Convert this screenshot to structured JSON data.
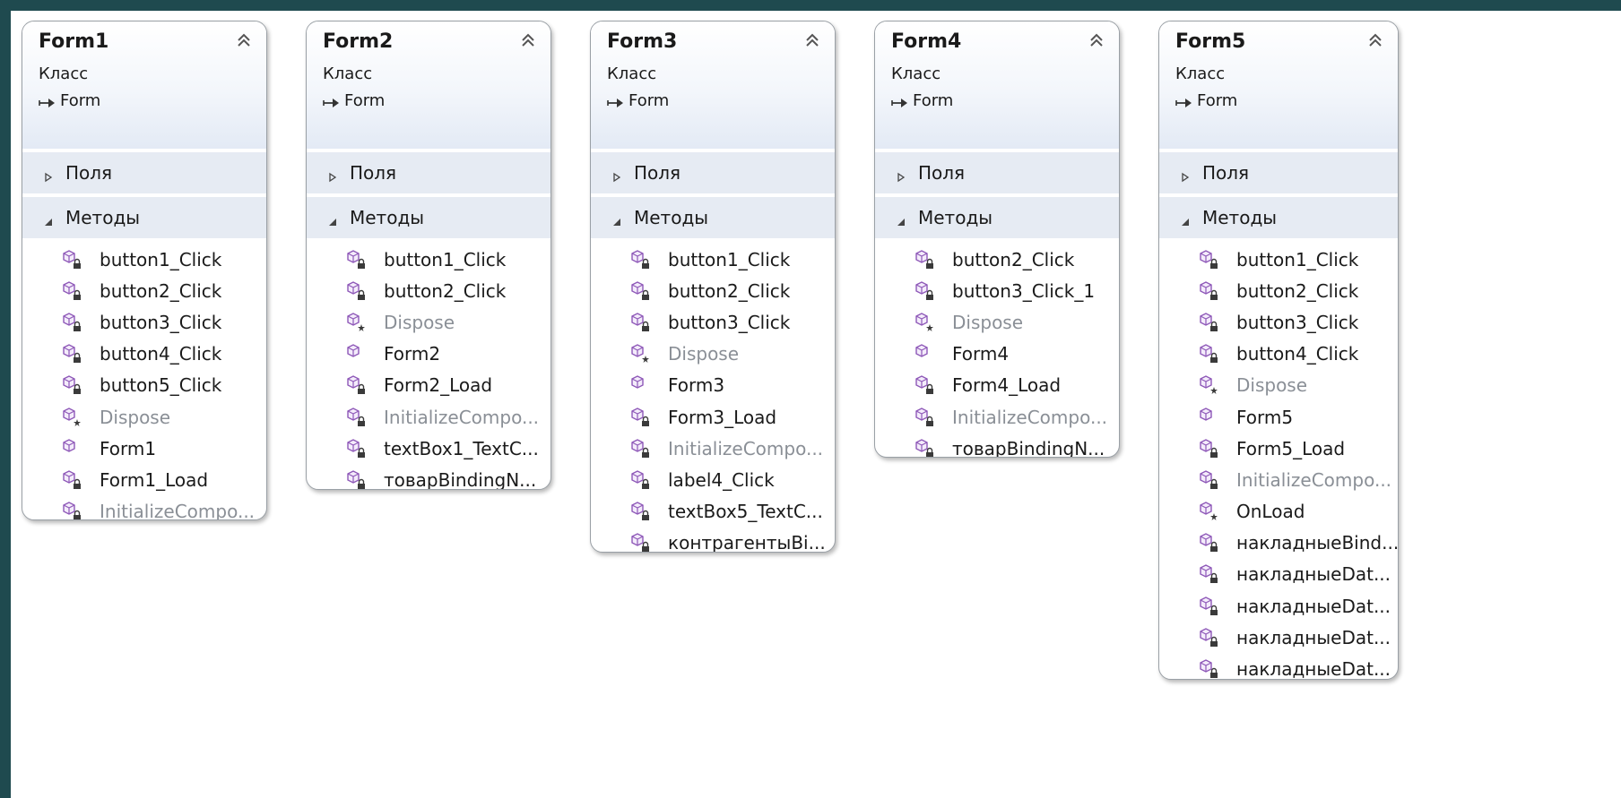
{
  "classes": [
    {
      "name": "Form1",
      "kind": "Класс",
      "base": "Form",
      "fields_label": "Поля",
      "methods_label": "Методы",
      "methods": [
        {
          "name": "button1_Click",
          "access": "private",
          "dim": false
        },
        {
          "name": "button2_Click",
          "access": "private",
          "dim": false
        },
        {
          "name": "button3_Click",
          "access": "private",
          "dim": false
        },
        {
          "name": "button4_Click",
          "access": "private",
          "dim": false
        },
        {
          "name": "button5_Click",
          "access": "private",
          "dim": false
        },
        {
          "name": "Dispose",
          "access": "protected",
          "dim": true
        },
        {
          "name": "Form1",
          "access": "public",
          "dim": false
        },
        {
          "name": "Form1_Load",
          "access": "private",
          "dim": false
        },
        {
          "name": "InitializeCompo...",
          "access": "private",
          "dim": true
        }
      ]
    },
    {
      "name": "Form2",
      "kind": "Класс",
      "base": "Form",
      "fields_label": "Поля",
      "methods_label": "Методы",
      "methods": [
        {
          "name": "button1_Click",
          "access": "private",
          "dim": false
        },
        {
          "name": "button2_Click",
          "access": "private",
          "dim": false
        },
        {
          "name": "Dispose",
          "access": "protected",
          "dim": true
        },
        {
          "name": "Form2",
          "access": "public",
          "dim": false
        },
        {
          "name": "Form2_Load",
          "access": "private",
          "dim": false
        },
        {
          "name": "InitializeCompo...",
          "access": "private",
          "dim": true
        },
        {
          "name": "textBox1_TextC...",
          "access": "private",
          "dim": false
        },
        {
          "name": "товарBindingN...",
          "access": "private",
          "dim": false
        }
      ]
    },
    {
      "name": "Form3",
      "kind": "Класс",
      "base": "Form",
      "fields_label": "Поля",
      "methods_label": "Методы",
      "methods": [
        {
          "name": "button1_Click",
          "access": "private",
          "dim": false
        },
        {
          "name": "button2_Click",
          "access": "private",
          "dim": false
        },
        {
          "name": "button3_Click",
          "access": "private",
          "dim": false
        },
        {
          "name": "Dispose",
          "access": "protected",
          "dim": true
        },
        {
          "name": "Form3",
          "access": "public",
          "dim": false
        },
        {
          "name": "Form3_Load",
          "access": "private",
          "dim": false
        },
        {
          "name": "InitializeCompo...",
          "access": "private",
          "dim": true
        },
        {
          "name": "label4_Click",
          "access": "private",
          "dim": false
        },
        {
          "name": "textBox5_TextC...",
          "access": "private",
          "dim": false
        },
        {
          "name": "контрагентыBi...",
          "access": "private",
          "dim": false
        }
      ]
    },
    {
      "name": "Form4",
      "kind": "Класс",
      "base": "Form",
      "fields_label": "Поля",
      "methods_label": "Методы",
      "methods": [
        {
          "name": "button2_Click",
          "access": "private",
          "dim": false
        },
        {
          "name": "button3_Click_1",
          "access": "private",
          "dim": false
        },
        {
          "name": "Dispose",
          "access": "protected",
          "dim": true
        },
        {
          "name": "Form4",
          "access": "public",
          "dim": false
        },
        {
          "name": "Form4_Load",
          "access": "private",
          "dim": false
        },
        {
          "name": "InitializeCompo...",
          "access": "private",
          "dim": true
        },
        {
          "name": "товарBindingN...",
          "access": "private",
          "dim": false
        }
      ]
    },
    {
      "name": "Form5",
      "kind": "Класс",
      "base": "Form",
      "fields_label": "Поля",
      "methods_label": "Методы",
      "methods": [
        {
          "name": "button1_Click",
          "access": "private",
          "dim": false
        },
        {
          "name": "button2_Click",
          "access": "private",
          "dim": false
        },
        {
          "name": "button3_Click",
          "access": "private",
          "dim": false
        },
        {
          "name": "button4_Click",
          "access": "private",
          "dim": false
        },
        {
          "name": "Dispose",
          "access": "protected",
          "dim": true
        },
        {
          "name": "Form5",
          "access": "public",
          "dim": false
        },
        {
          "name": "Form5_Load",
          "access": "private",
          "dim": false
        },
        {
          "name": "InitializeCompo...",
          "access": "private",
          "dim": true
        },
        {
          "name": "OnLoad",
          "access": "protected",
          "dim": false
        },
        {
          "name": "накладныеBind...",
          "access": "private",
          "dim": false
        },
        {
          "name": "накладныеDat...",
          "access": "private",
          "dim": false
        },
        {
          "name": "накладныеDat...",
          "access": "private",
          "dim": false
        },
        {
          "name": "накладныеDat...",
          "access": "private",
          "dim": false
        },
        {
          "name": "накладныеDat...",
          "access": "private",
          "dim": false
        }
      ]
    }
  ],
  "icons": {
    "collapse": "double-chevron-up-icon",
    "inherits": "inheritance-arrow-icon",
    "expand": "triangle-right-icon",
    "expanded": "triangle-down-icon",
    "method": "method-cube-icon"
  },
  "colors": {
    "method_icon": "#8e58b8",
    "section_bg": "#e6ebf3",
    "dim_text": "#8a8f96"
  }
}
